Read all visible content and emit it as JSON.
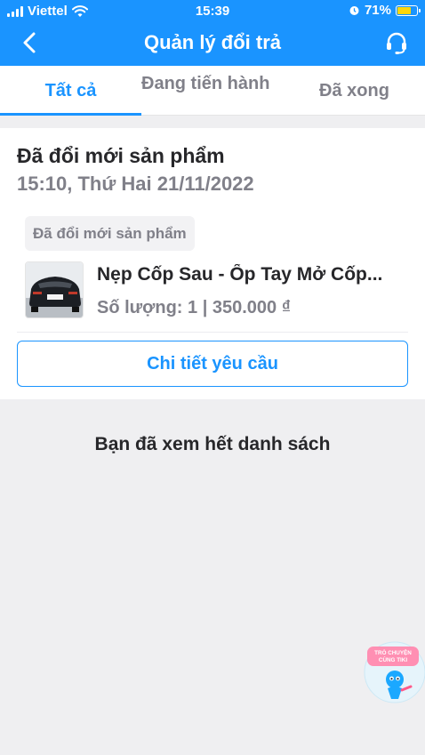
{
  "status_bar": {
    "carrier": "Viettel",
    "time": "15:39",
    "battery_percent": "71%",
    "battery_level": 0.71
  },
  "header": {
    "title": "Quản lý đổi trả",
    "back_icon": "chevron-left-icon",
    "support_icon": "headset-icon",
    "color": "#1a94ff"
  },
  "tabs": [
    {
      "label": "Tất cả",
      "active": true
    },
    {
      "label": "Đang tiến hành",
      "active": false
    },
    {
      "label": "Đã xong",
      "active": false
    }
  ],
  "request": {
    "title": "Đã đổi mới sản phẩm",
    "datetime": "15:10, Thứ Hai 21/11/2022",
    "status_badge": "Đã đổi mới sản phẩm",
    "product": {
      "name": "Nẹp Cốp Sau - Ốp Tay Mở Cốp...",
      "meta": "Số lượng: 1 | 350.000 ₫"
    },
    "detail_button": "Chi tiết yêu cầu"
  },
  "end_message": "Bạn đã xem hết danh sách",
  "chat_widget": {
    "label": "TRÒ CHUYỆN CÙNG TIKI",
    "icon": "tiki-mascot-icon"
  }
}
